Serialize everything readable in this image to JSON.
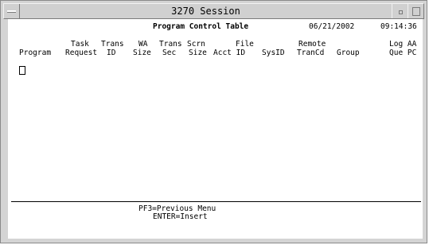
{
  "window": {
    "title": "3270 Session"
  },
  "screen": {
    "screen_title": "Program Control Table",
    "date": "06/21/2002",
    "time": "09:14:36",
    "columns": [
      {
        "top": "",
        "bottom": "Program"
      },
      {
        "top": "Task",
        "bottom": "Request"
      },
      {
        "top": "Trans",
        "bottom": "ID"
      },
      {
        "top": "WA",
        "bottom": "Size"
      },
      {
        "top": "Trans",
        "bottom": "Sec"
      },
      {
        "top": "Scrn",
        "bottom": "Size"
      },
      {
        "top": "File",
        "bottom": "Acct ID"
      },
      {
        "top": "",
        "bottom": "SysID"
      },
      {
        "top": "Remote",
        "bottom": "TranCd"
      },
      {
        "top": "",
        "bottom": "Group"
      },
      {
        "top": "Log AA",
        "bottom": "Que PC"
      }
    ],
    "function_keys": [
      "PF3=Previous Menu",
      "ENTER=Insert"
    ]
  }
}
